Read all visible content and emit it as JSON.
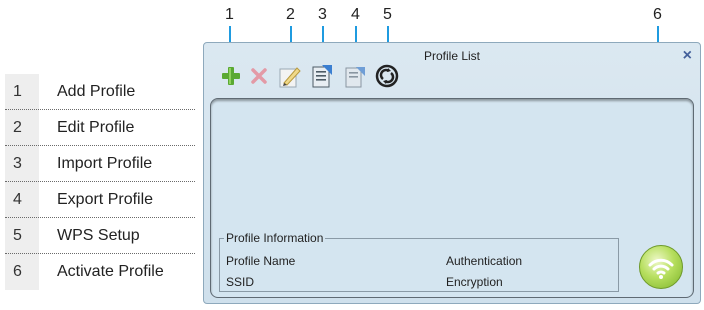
{
  "legend": [
    {
      "num": "1",
      "label": "Add Profile"
    },
    {
      "num": "2",
      "label": "Edit Profile"
    },
    {
      "num": "3",
      "label": "Import Profile"
    },
    {
      "num": "4",
      "label": "Export Profile"
    },
    {
      "num": "5",
      "label": "WPS Setup"
    },
    {
      "num": "6",
      "label": "Activate Profile"
    }
  ],
  "callouts": [
    "1",
    "2",
    "3",
    "4",
    "5",
    "6"
  ],
  "window": {
    "title": "Profile List",
    "close_glyph": "×"
  },
  "toolbar": [
    {
      "name": "add-profile",
      "icon": "plus-icon"
    },
    {
      "name": "delete-profile",
      "icon": "x-icon"
    },
    {
      "name": "edit-profile",
      "icon": "pencil-icon"
    },
    {
      "name": "import-profile",
      "icon": "import-icon"
    },
    {
      "name": "export-profile",
      "icon": "export-icon"
    },
    {
      "name": "wps-setup",
      "icon": "wps-icon"
    }
  ],
  "profile_info": {
    "legend": "Profile Information",
    "profile_name_label": "Profile Name",
    "ssid_label": "SSID",
    "authentication_label": "Authentication",
    "encryption_label": "Encryption"
  },
  "activate": {
    "icon": "wifi-icon"
  },
  "colors": {
    "callout_line": "#1f9be0",
    "add_icon": "#5aa932",
    "delete_icon": "#e39aa6",
    "close": "#43609b"
  }
}
